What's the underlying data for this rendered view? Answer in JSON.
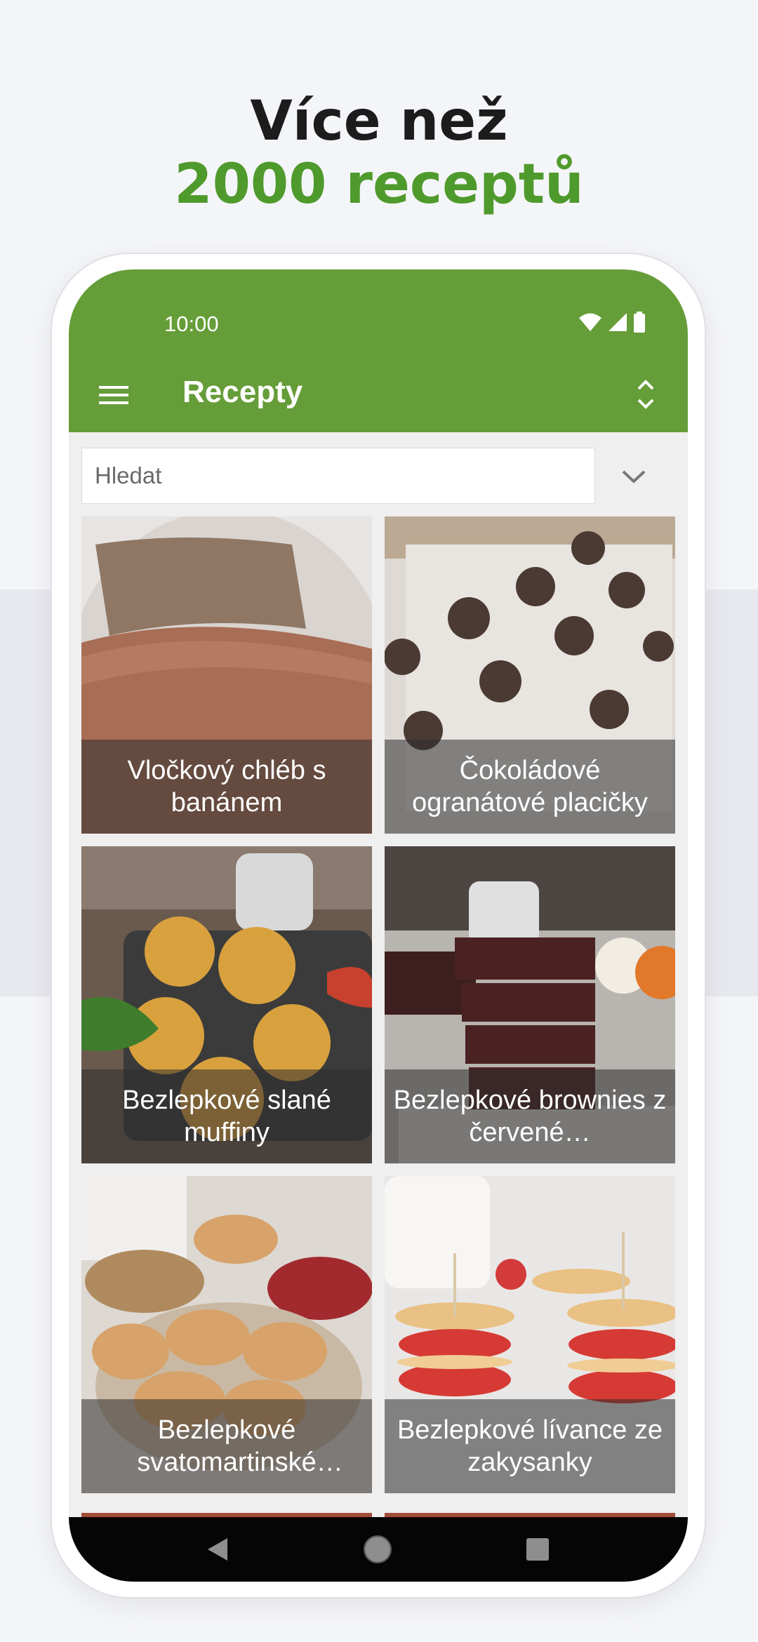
{
  "promo": {
    "headline_line1": "Více než",
    "headline_line2": "2000 receptů",
    "accent_color": "#4f9a2c"
  },
  "status_bar": {
    "time": "10:00",
    "icons": [
      "wifi-icon",
      "signal-icon",
      "battery-icon"
    ]
  },
  "app_bar": {
    "title": "Recepty",
    "background": "#659d38",
    "menu_icon": "menu-icon",
    "sort_icon": "sort-icon"
  },
  "search": {
    "placeholder": "Hledat",
    "value": "",
    "expand_icon": "chevron-down-icon"
  },
  "recipes": [
    {
      "title": "Vločkový chléb s banánem"
    },
    {
      "title": "Čokoládové ogranátové placičky"
    },
    {
      "title": "Bezlepkové slané muffiny"
    },
    {
      "title": "Bezlepkové brownies z červené…"
    },
    {
      "title": "Bezlepkové svatomartinské rohlíčky"
    },
    {
      "title": "Bezlepkové lívance ze zakysanky"
    }
  ],
  "nav_bar": {
    "icons": [
      "back-icon",
      "home-icon",
      "recents-icon"
    ]
  }
}
